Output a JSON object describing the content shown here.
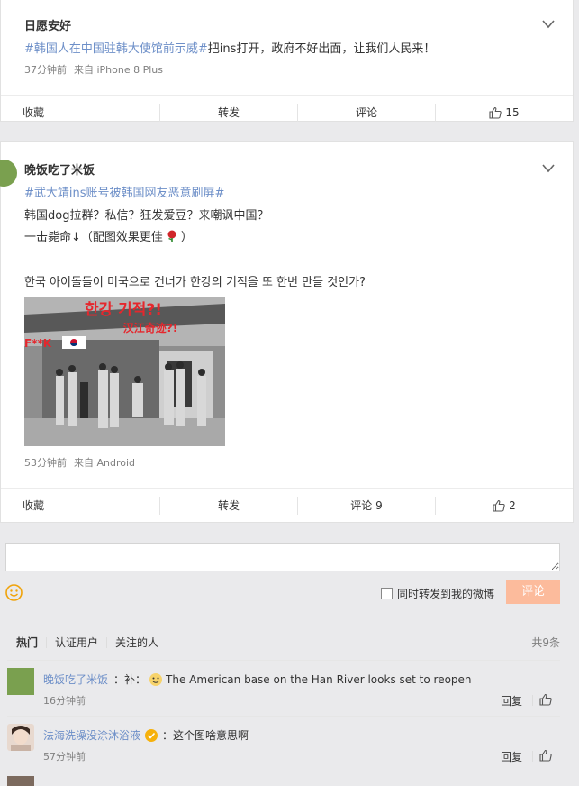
{
  "post1": {
    "author": "日愿安好",
    "hashtag": "#韩国人在中国驻韩大使馆前示威#",
    "text": "把ins打开，政府不好出面，让我们人民来！",
    "time": "37分钟前",
    "source": "来自 iPhone 8 Plus",
    "actions": {
      "favorite": "收藏",
      "repost": "转发",
      "comment": "评论",
      "like_count": "15"
    }
  },
  "post2": {
    "author": "晚饭吃了米饭",
    "hashtag": "#武大靖ins账号被韩国网友恶意刷屏#",
    "line1": "韩国dog拉群？私信？狂发爱豆？来嘲讽中国？",
    "line2": "一击毙命↓（配图效果更佳",
    "line2_end": "）",
    "korean": "한국 아이돌들이 미국으로 건너가 한강의 기적을 또 한번 만들 것인가?",
    "image_text": {
      "title": "한강 기적?!",
      "subtitle": "汉江奇迹?!",
      "side": "F**K"
    },
    "time": "53分钟前",
    "source": "来自 Android",
    "actions": {
      "favorite": "收藏",
      "repost": "转发",
      "comment": "评论 9",
      "like_count": "2"
    }
  },
  "compose": {
    "placeholder": "",
    "sync_label": "同时转发到我的微博",
    "submit_label": "评论"
  },
  "comment_tabs": {
    "tabs": [
      "热门",
      "认证用户",
      "关注的人"
    ],
    "total": "共9条"
  },
  "comments": [
    {
      "user": "晚饭吃了米饭",
      "text": "：补：",
      "text2": "The American base on the Han River looks set to reopen",
      "time": "16分钟前",
      "reply": "回复"
    },
    {
      "user": "法海洗澡没涂沐浴液",
      "text": "：这个图啥意思啊",
      "time": "57分钟前",
      "reply": "回复"
    }
  ],
  "colors": {
    "link": "#6d8fc8",
    "submit_bg": "#fcbb9c",
    "page_bg": "#eaeaec"
  },
  "icons": [
    "chevron-down-icon",
    "thumbs-up-icon",
    "emoji-icon",
    "rose-icon",
    "verified-badge-icon",
    "sticker-icon"
  ]
}
